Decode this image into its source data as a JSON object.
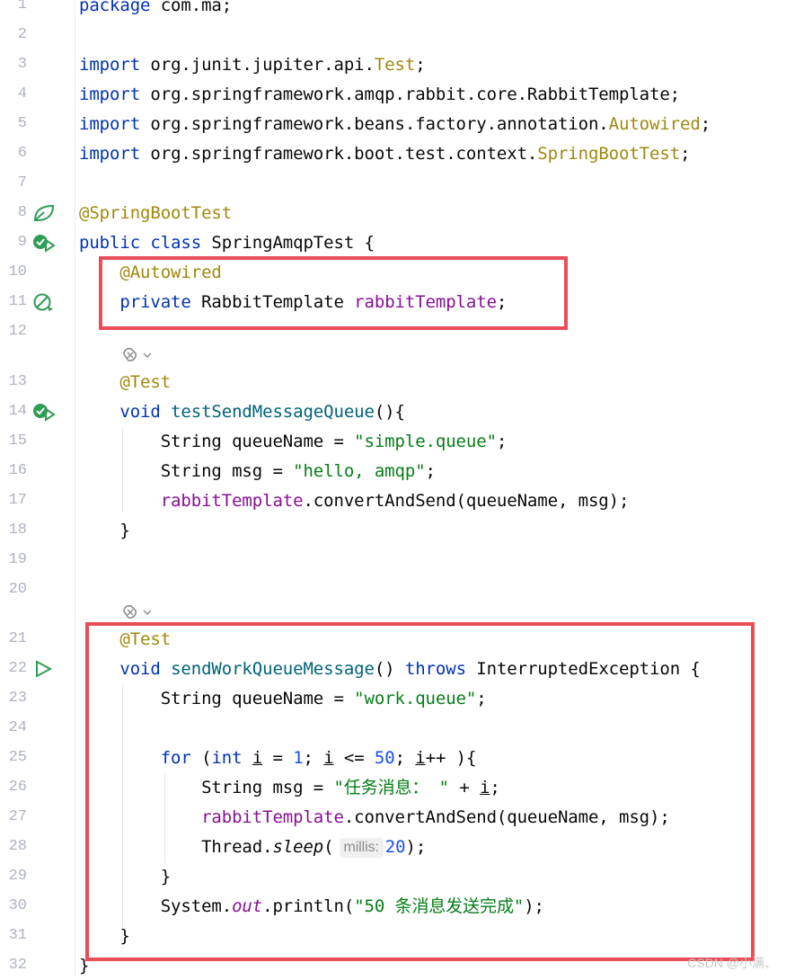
{
  "colors": {
    "keyword": "#0033b3",
    "annotation": "#9e880d",
    "field": "#871094",
    "string": "#067d17",
    "number": "#1750eb",
    "method": "#00627a",
    "highlight_box": "#e94e58",
    "gutter_icon": "#2f9d55"
  },
  "lines": {
    "l1": {
      "no": "1",
      "a": "package",
      "b": " com.ma;"
    },
    "l2": {
      "no": "2"
    },
    "l3": {
      "no": "3",
      "a": "import",
      "b": " org.junit.jupiter.api.",
      "c": "Test",
      "d": ";"
    },
    "l4": {
      "no": "4",
      "a": "import",
      "b": " org.springframework.amqp.rabbit.core.RabbitTemplate;"
    },
    "l5": {
      "no": "5",
      "a": "import",
      "b": " org.springframework.beans.factory.annotation.",
      "c": "Autowired",
      "d": ";"
    },
    "l6": {
      "no": "6",
      "a": "import",
      "b": " org.springframework.boot.test.context.",
      "c": "SpringBootTest",
      "d": ";"
    },
    "l7": {
      "no": "7"
    },
    "l8": {
      "no": "8",
      "a": "@SpringBootTest"
    },
    "l9": {
      "no": "9",
      "a": "public class",
      "b": " SpringAmqpTest {"
    },
    "l10": {
      "no": "10",
      "a": "    ",
      "b": "@Autowired"
    },
    "l11": {
      "no": "11",
      "a": "    ",
      "b": "private",
      "c": " RabbitTemplate ",
      "d": "rabbitTemplate",
      "e": ";"
    },
    "l12": {
      "no": "12"
    },
    "l13": {
      "no": "13",
      "a": "    ",
      "b": "@Test"
    },
    "l14": {
      "no": "14",
      "a": "    ",
      "b": "void",
      "c": " ",
      "d": "testSendMessageQueue",
      "e": "(){"
    },
    "l15": {
      "no": "15",
      "a": "        String queueName = ",
      "b": "\"simple.queue\"",
      "c": ";"
    },
    "l16": {
      "no": "16",
      "a": "        String msg = ",
      "b": "\"hello, amqp\"",
      "c": ";"
    },
    "l17": {
      "no": "17",
      "a": "        ",
      "b": "rabbitTemplate",
      "c": ".convertAndSend(queueName, msg);"
    },
    "l18": {
      "no": "18",
      "a": "    }"
    },
    "l19": {
      "no": "19"
    },
    "l20": {
      "no": "20"
    },
    "l21": {
      "no": "21",
      "a": "    ",
      "b": "@Test"
    },
    "l22": {
      "no": "22",
      "a": "    ",
      "b": "void",
      "c": " ",
      "d": "sendWorkQueueMessage",
      "e": "() ",
      "f": "throws",
      "g": " InterruptedException {"
    },
    "l23": {
      "no": "23",
      "a": "        String queueName = ",
      "b": "\"work.queue\"",
      "c": ";"
    },
    "l24": {
      "no": "24"
    },
    "l25": {
      "no": "25",
      "a": "        ",
      "b": "for",
      "c": " (",
      "d": "int",
      "e": " ",
      "f": "i",
      "g": " = ",
      "h": "1",
      "i": "; ",
      "j": "i",
      "k": " <= ",
      "l": "50",
      "m": "; ",
      "n": "i",
      "o": "++ ){"
    },
    "l26": {
      "no": "26",
      "a": "            String msg = ",
      "b": "\"任务消息： \"",
      "c": " + ",
      "d": "i",
      "e": ";"
    },
    "l27": {
      "no": "27",
      "a": "            ",
      "b": "rabbitTemplate",
      "c": ".convertAndSend(queueName, msg);"
    },
    "l28": {
      "no": "28",
      "a": "            Thread.",
      "b": "sleep",
      "c": "(",
      "hint": "millis:",
      "d": "20",
      "e": ");"
    },
    "l29": {
      "no": "29",
      "a": "        }"
    },
    "l30": {
      "no": "30",
      "a": "        System.",
      "b": "out",
      "c": ".println(",
      "d": "\"50 条消息发送完成\"",
      "e": ");"
    },
    "l31": {
      "no": "31",
      "a": "    }"
    },
    "l32": {
      "no": "32",
      "a": "}"
    }
  },
  "icons": {
    "spring_bean": "spring-leaf-icon",
    "run_test": "run-test-icon",
    "inject": "inject-icon",
    "run": "run-icon",
    "ai": "ai-sparkle-icon"
  },
  "watermark": "CSDN @小满、"
}
